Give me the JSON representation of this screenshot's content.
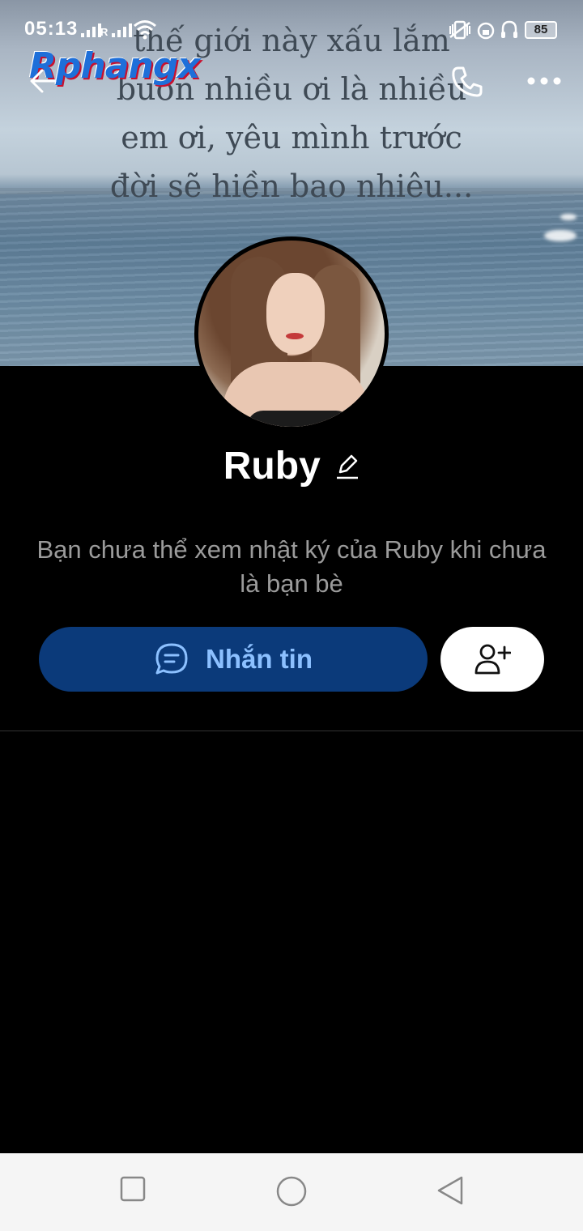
{
  "status_bar": {
    "time": "05:13",
    "roaming_label": "R",
    "battery": "85"
  },
  "cover": {
    "poem_lines": [
      "thế giới này xấu lắm",
      "buồn nhiều ơi là nhiều",
      "em ơi, yêu mình trước",
      "đời sẽ hiền bao nhiêu..."
    ],
    "watermark": "Rphangx"
  },
  "header": {
    "back_icon": "arrow-left-icon",
    "call_icon": "phone-icon",
    "more_icon": "more-horizontal-icon"
  },
  "profile": {
    "name": "Ruby",
    "edit_icon": "pencil-icon",
    "notice": "Bạn chưa thể xem nhật ký của Ruby khi chưa là bạn bè"
  },
  "actions": {
    "message_label": "Nhắn tin",
    "message_icon": "chat-bubble-icon",
    "add_friend_icon": "add-user-icon"
  },
  "colors": {
    "message_button_bg": "#0b3a7a",
    "message_button_text": "#8cc0ff"
  },
  "nav_bar": {
    "icons": [
      "square-icon",
      "circle-icon",
      "triangle-back-icon"
    ]
  }
}
